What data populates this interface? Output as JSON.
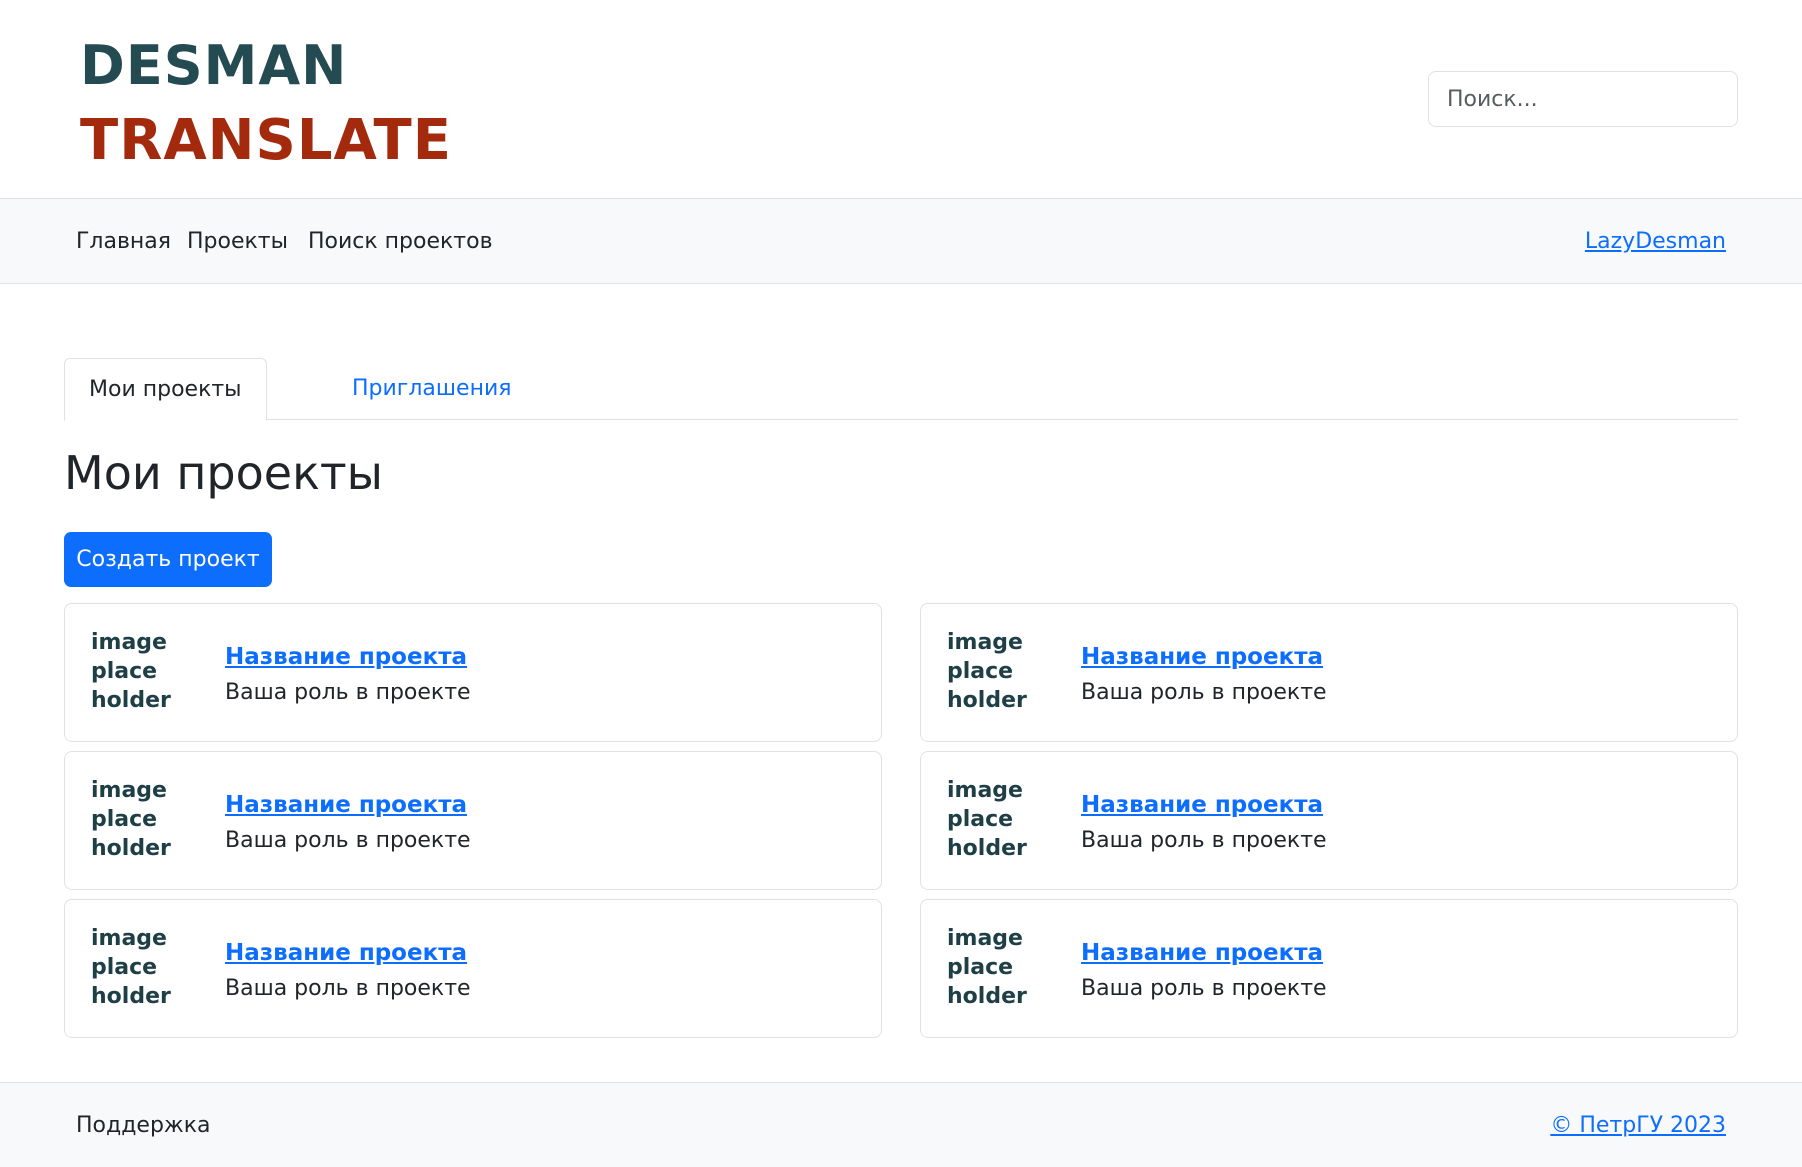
{
  "logo": {
    "line1": "DESMAN",
    "line2": "TRANSLATE",
    "color1": "#244a52",
    "color2": "#a42a0e"
  },
  "search": {
    "placeholder": "Поиск...",
    "value": ""
  },
  "nav": {
    "items": [
      {
        "label": "Главная"
      },
      {
        "label": "Проекты"
      },
      {
        "label": "Поиск проектов"
      }
    ],
    "user": "LazyDesman"
  },
  "tabs": [
    {
      "label": "Мои проекты",
      "active": true
    },
    {
      "label": "Приглашения",
      "active": false
    }
  ],
  "page_title": "Мои проекты",
  "create_button": "Создать проект",
  "projects": [
    {
      "image": "image place holder",
      "name": "Название проекта",
      "role": "Ваша роль в проекте"
    },
    {
      "image": "image place holder",
      "name": "Название проекта",
      "role": "Ваша роль в проекте"
    },
    {
      "image": "image place holder",
      "name": "Название проекта",
      "role": "Ваша роль в проекте"
    },
    {
      "image": "image place holder",
      "name": "Название проекта",
      "role": "Ваша роль в проекте"
    },
    {
      "image": "image place holder",
      "name": "Название проекта",
      "role": "Ваша роль в проекте"
    },
    {
      "image": "image place holder",
      "name": "Название проекта",
      "role": "Ваша роль в проекте"
    }
  ],
  "footer": {
    "support": "Поддержка",
    "copyright": "© ПетрГУ 2023"
  },
  "colors": {
    "accent": "#0d6efd",
    "bar_bg": "#f8f9fa",
    "border": "#dee2e6"
  }
}
